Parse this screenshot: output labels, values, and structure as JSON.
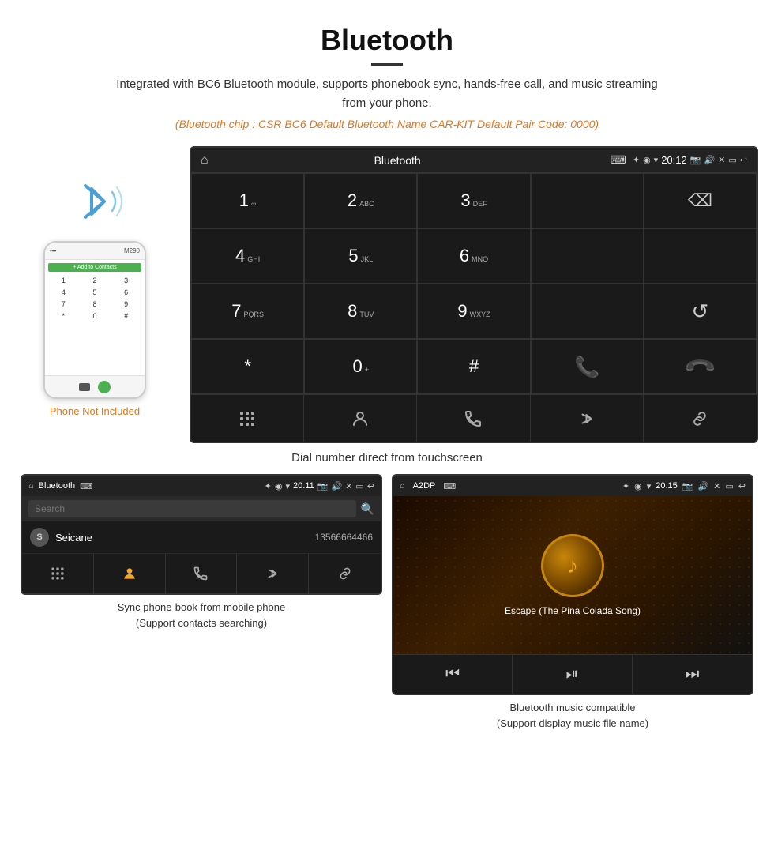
{
  "header": {
    "title": "Bluetooth",
    "description": "Integrated with BC6 Bluetooth module, supports phonebook sync, hands-free call, and music streaming from your phone.",
    "specs": "(Bluetooth chip : CSR BC6    Default Bluetooth Name CAR-KIT    Default Pair Code: 0000)"
  },
  "phone_label": "Phone Not Included",
  "main_screen": {
    "status_bar": {
      "title": "Bluetooth",
      "usb": "✦",
      "time": "20:12",
      "icons": "✦ ◉ ▾"
    },
    "dial_pad": [
      {
        "num": "1",
        "sub": ""
      },
      {
        "num": "2",
        "sub": "ABC"
      },
      {
        "num": "3",
        "sub": "DEF"
      },
      {
        "num": "",
        "sub": ""
      },
      {
        "num": "⌫",
        "sub": ""
      }
    ],
    "row2": [
      {
        "num": "4",
        "sub": "GHI"
      },
      {
        "num": "5",
        "sub": "JKL"
      },
      {
        "num": "6",
        "sub": "MNO"
      },
      {
        "num": "",
        "sub": ""
      },
      {
        "num": "",
        "sub": ""
      }
    ],
    "row3": [
      {
        "num": "7",
        "sub": "PQRS"
      },
      {
        "num": "8",
        "sub": "TUV"
      },
      {
        "num": "9",
        "sub": "WXYZ"
      },
      {
        "num": "",
        "sub": ""
      },
      {
        "num": "↺",
        "sub": ""
      }
    ],
    "row4": [
      {
        "num": "*",
        "sub": ""
      },
      {
        "num": "0",
        "sub": "+"
      },
      {
        "num": "#",
        "sub": ""
      },
      {
        "num": "📞",
        "sub": ""
      },
      {
        "num": "📞",
        "sub": "red"
      }
    ],
    "bottom_nav": [
      "⊞",
      "👤",
      "📞",
      "✱",
      "🔗"
    ]
  },
  "screen_caption": "Dial number direct from touchscreen",
  "phonebook_panel": {
    "status_bar": {
      "home": "⌂",
      "title": "Bluetooth",
      "usb": "✦",
      "time": "20:11",
      "icons": "✦ ◉ ▾"
    },
    "search_placeholder": "Search",
    "contacts": [
      {
        "initial": "S",
        "name": "Seicane",
        "number": "13566664466"
      }
    ],
    "bottom_nav": [
      "⊞",
      "👤",
      "📞",
      "✱",
      "🔗"
    ]
  },
  "music_panel": {
    "status_bar": {
      "home": "⌂",
      "title": "A2DP",
      "usb": "✦",
      "time": "20:15"
    },
    "song_title": "Escape (The Pina Colada Song)",
    "controls": [
      "⏮",
      "⏯",
      "⏭"
    ]
  },
  "bottom_captions": {
    "phonebook": "Sync phone-book from mobile phone\n(Support contacts searching)",
    "music": "Bluetooth music compatible\n(Support display music file name)"
  }
}
